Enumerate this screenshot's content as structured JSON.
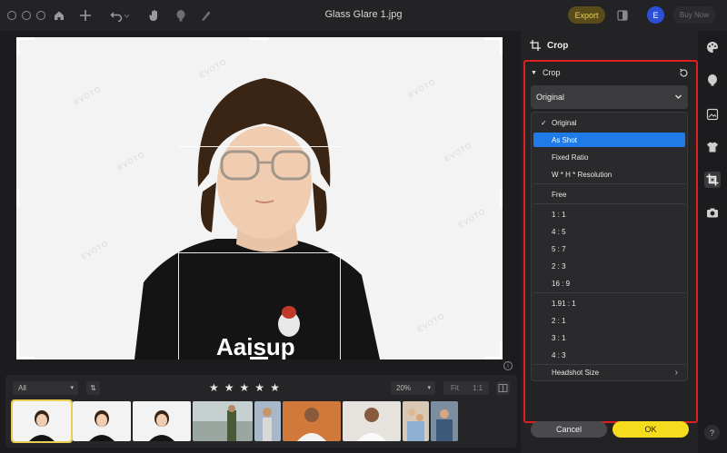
{
  "window": {
    "title": "Glass Glare 1.jpg"
  },
  "toolbar": {
    "export_label": "Export",
    "avatar_initial": "E",
    "buy_now_label": "Buy Now"
  },
  "photo": {
    "watermark": "EVOTO",
    "shirt_text": "Aaisup"
  },
  "filmstrip": {
    "filter_value": "All",
    "sort_icon": "sort-icon",
    "rating_stars": [
      "★",
      "★",
      "★",
      "★",
      "★"
    ],
    "zoom_value": "20%",
    "fit_label": "Fit",
    "actual_label": "1:1",
    "thumbnail_count": 8
  },
  "panel": {
    "header_label": "Crop",
    "section_label": "Crop",
    "ratio_selected": "Original",
    "options": [
      {
        "label": "Original",
        "checked": true,
        "highlighted": false
      },
      {
        "label": "As Shot",
        "checked": false,
        "highlighted": true
      },
      {
        "label": "Fixed Ratio",
        "checked": false,
        "highlighted": false
      },
      {
        "label": "W * H * Resolution",
        "checked": false,
        "highlighted": false
      },
      {
        "label": "Free",
        "checked": false,
        "highlighted": false
      },
      {
        "label": "1 : 1",
        "checked": false,
        "highlighted": false
      },
      {
        "label": "4 : 5",
        "checked": false,
        "highlighted": false
      },
      {
        "label": "5 : 7",
        "checked": false,
        "highlighted": false
      },
      {
        "label": "2 : 3",
        "checked": false,
        "highlighted": false
      },
      {
        "label": "16 : 9",
        "checked": false,
        "highlighted": false
      },
      {
        "label": "1.91 : 1",
        "checked": false,
        "highlighted": false
      },
      {
        "label": "2 : 1",
        "checked": false,
        "highlighted": false
      },
      {
        "label": "3 : 1",
        "checked": false,
        "highlighted": false
      },
      {
        "label": "4 : 3",
        "checked": false,
        "highlighted": false
      },
      {
        "label": "Headshot Size",
        "checked": false,
        "highlighted": false,
        "submenu": true
      }
    ],
    "cancel_label": "Cancel",
    "ok_label": "OK"
  },
  "help_label": "?",
  "colors": {
    "accent_yellow": "#f5dd1e",
    "highlight_blue": "#1e7be8",
    "annotation_red": "#e02020",
    "avatar_blue": "#2c4fd7"
  }
}
